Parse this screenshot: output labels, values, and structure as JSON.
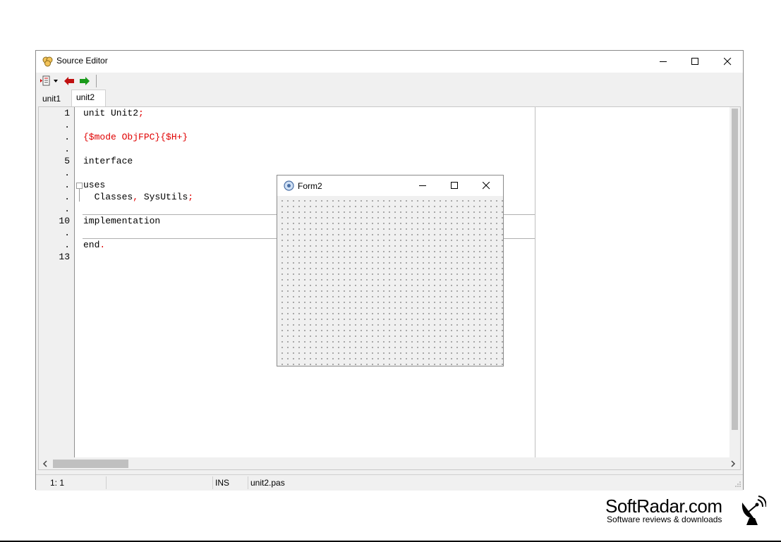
{
  "editor": {
    "title": "Source Editor",
    "tabs": [
      {
        "label": "unit1"
      },
      {
        "label": "unit2"
      }
    ],
    "active_tab": "unit2",
    "line_numbers": [
      "1",
      ".",
      ".",
      ".",
      "5",
      ".",
      ".",
      ".",
      ".",
      "10",
      ".",
      ".",
      "13"
    ],
    "code": {
      "l1a": "unit Unit2",
      "l1b": ";",
      "l3": "{$mode ObjFPC}{$H+}",
      "l5": "interface",
      "l7": "uses",
      "l8a": "  Classes",
      "l8b": ",",
      "l8c": " SysUtils",
      "l8d": ";",
      "l10": "implementation",
      "l12a": "end",
      "l12b": "."
    }
  },
  "statusbar": {
    "position": "1:  1",
    "mode": "INS",
    "filename": "unit2.pas"
  },
  "form2": {
    "title": "Form2"
  },
  "watermark": {
    "name": "SoftRadar.com",
    "tagline": "Software reviews & downloads"
  },
  "colors": {
    "directive": "#e00000",
    "window_bg": "#f0f0f0"
  },
  "icons": {
    "titlebar": "lazarus-icon",
    "toolbar": [
      "list-dropdown-icon",
      "back-arrow-icon",
      "forward-arrow-icon"
    ]
  }
}
